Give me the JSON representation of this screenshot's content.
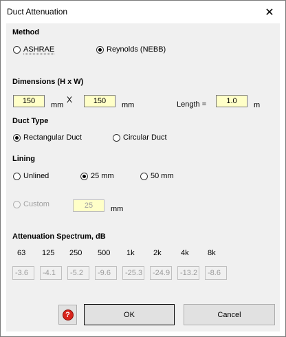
{
  "window": {
    "title": "Duct Attenuation",
    "close_glyph": "✕"
  },
  "method": {
    "label": "Method",
    "options": [
      {
        "label": "ASHRAE",
        "checked": false
      },
      {
        "label": "Reynolds (NEBB)",
        "checked": true
      }
    ]
  },
  "dimensions": {
    "label": "Dimensions (H x W)",
    "height": "150",
    "height_unit": "mm",
    "times": "X",
    "width": "150",
    "width_unit": "mm",
    "length_label": "Length =",
    "length": "1.0",
    "length_unit": "m"
  },
  "duct_type": {
    "label": "Duct Type",
    "options": [
      {
        "label": "Rectangular Duct",
        "checked": true
      },
      {
        "label": "Circular Duct",
        "checked": false
      }
    ]
  },
  "lining": {
    "label": "Lining",
    "options": [
      {
        "label": "Unlined",
        "checked": false
      },
      {
        "label": "25 mm",
        "checked": true
      },
      {
        "label": "50 mm",
        "checked": false
      }
    ],
    "custom_label": "Custom",
    "custom_value": "25",
    "custom_unit": "mm"
  },
  "spectrum": {
    "label": "Attenuation Spectrum, dB",
    "frequencies": [
      "63",
      "125",
      "250",
      "500",
      "1k",
      "2k",
      "4k",
      "8k"
    ],
    "values": [
      "-3.6",
      "-4.1",
      "-5.2",
      "-9.6",
      "-25.3",
      "-24.9",
      "-13.2",
      "-8.6"
    ]
  },
  "buttons": {
    "help_icon": "question-icon",
    "ok": "OK",
    "cancel": "Cancel"
  }
}
